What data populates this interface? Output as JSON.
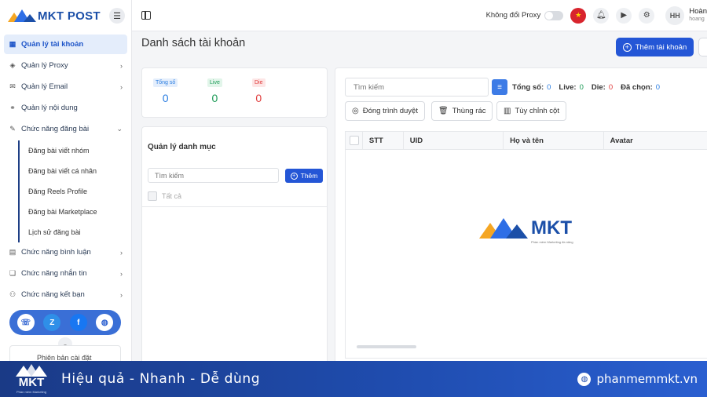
{
  "app": {
    "brand": "MKT POST"
  },
  "sidebar": {
    "items": [
      {
        "label": "Quản lý tài khoản",
        "icon": "grid-icon",
        "active": true
      },
      {
        "label": "Quản lý Proxy",
        "icon": "layers-icon",
        "chevron": true
      },
      {
        "label": "Quản lý Email",
        "icon": "mail-icon",
        "chevron": true
      },
      {
        "label": "Quản lý nội dung",
        "icon": "link-icon"
      },
      {
        "label": "Chức năng đăng bài",
        "icon": "edit-icon",
        "expanded": true
      }
    ],
    "sub_items": [
      "Đăng bài viết nhóm",
      "Đăng bài viết cá nhân",
      "Đăng Reels Profile",
      "Đăng bài Marketplace",
      "Lịch sử đăng bài"
    ],
    "items_after": [
      {
        "label": "Chức năng bình luận",
        "icon": "comment-icon"
      },
      {
        "label": "Chức năng nhắn tin",
        "icon": "chat-icon"
      },
      {
        "label": "Chức năng kết bạn",
        "icon": "add-friend-icon"
      }
    ],
    "version_label": "Phiên bản cài đặt"
  },
  "topbar": {
    "proxy_label": "Không đổi Proxy",
    "avatar_initials": "HH",
    "user_name": "Hoàn",
    "user_email": "hoang"
  },
  "main": {
    "title": "Danh sách tài khoản",
    "add_account_label": "Thêm tài khoản",
    "stats": [
      {
        "label": "Tổng số",
        "value": "0",
        "color": "#2a7de1",
        "bg": "#e4eefc"
      },
      {
        "label": "Live",
        "value": "0",
        "color": "#1a9a55",
        "bg": "#e2f5ea"
      },
      {
        "label": "Die",
        "value": "0",
        "color": "#e03b3b",
        "bg": "#fde6e6"
      }
    ],
    "category": {
      "title": "Quản lý danh mục",
      "search_placeholder": "Tìm kiếm",
      "add_label": "Thêm",
      "all_label": "Tất cả"
    },
    "table": {
      "search_placeholder": "Tìm kiếm",
      "counts": [
        {
          "label": "Tổng số:",
          "value": "0",
          "color": "#2a7de1"
        },
        {
          "label": "Live:",
          "value": "0",
          "color": "#1a9a55"
        },
        {
          "label": "Die:",
          "value": "0",
          "color": "#e03b3b"
        },
        {
          "label": "Đã chọn:",
          "value": "0",
          "color": "#2a7de1"
        }
      ],
      "tools": [
        "Đóng trình duyệt",
        "Thùng rác",
        "Tùy chỉnh cột"
      ],
      "columns": [
        "STT",
        "UID",
        "Họ và tên",
        "Avatar"
      ],
      "watermark": "MKT",
      "watermark_sub": "Phần mềm Marketing đa năng"
    }
  },
  "banner": {
    "logo_text": "MKT",
    "logo_sub": "Phần mềm Marketing",
    "slogan": "Hiệu quả - Nhanh  - Dễ dùng",
    "website": "phanmemmkt.vn"
  }
}
